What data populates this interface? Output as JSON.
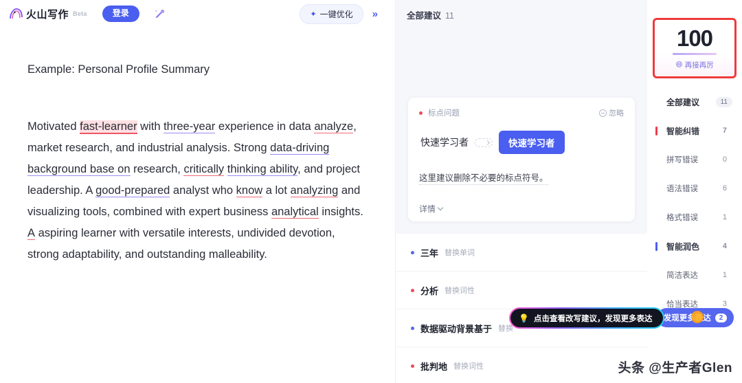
{
  "header": {
    "logo_icon": "volcano-logo-icon",
    "logo_text": "火山写作",
    "beta_badge": "Beta",
    "login_label": "登录",
    "magic_icon": "magic-wand-icon",
    "optimize_icon": "sparkle-icon",
    "optimize_label": "一键优化",
    "collapse_icon": "»"
  },
  "document": {
    "title": "Example: Personal Profile Summary",
    "line1_a": "Motivated ",
    "line1_err": "fast-learner",
    "line1_b": " with ",
    "line1_u1": "three-year",
    "line1_c": " experience in data",
    "line2_u1": "analyze",
    "line2_a": ", market research, and industrial analysis. Strong",
    "line3_u1": "data-driving background base on",
    "line3_a": " research, ",
    "line3_u2": "critically",
    "line4_u1": "thinking ability",
    "line4_a": ", and project leadership. A ",
    "line4_u2": "good-prepared",
    "line5_a": "analyst who ",
    "line5_u1": "know",
    "line5_b": " a lot ",
    "line5_u2": "analyzing",
    "line5_c": " and visualizing tools,",
    "line6_a": "combined with expert business ",
    "line6_u1": "analytical",
    "line6_b": " insights. ",
    "line6_u2": "A",
    "line7": "aspiring learner with versatile interests, undivided devotion,",
    "line8": "strong adaptability, and outstanding malleability."
  },
  "suggestions": {
    "header_label": "全部建议",
    "header_count": "11",
    "card": {
      "dot_color": "#ef4a5c",
      "tag": "标点问题",
      "ignore_icon": "ignore-circle-icon",
      "ignore_label": "忽略",
      "old_word": "快速学习者",
      "arrow_icon": "replace-arrow-icon",
      "new_word": "快速学习者",
      "description": "这里建议删除不必要的标点符号。",
      "more_label": "详情",
      "more_icon": "chevron-down-icon"
    },
    "items": [
      {
        "dot": "blue",
        "word": "三年",
        "kind": "替换单词"
      },
      {
        "dot": "red",
        "word": "分析",
        "kind": "替换词性"
      },
      {
        "dot": "blue",
        "word": "数据驱动背景基于",
        "kind": "替换"
      },
      {
        "dot": "red",
        "word": "批判地",
        "kind": "替换词性"
      }
    ],
    "tooltip": {
      "icon": "lightbulb-icon",
      "text": "点击查看改写建议，发现更多表达"
    }
  },
  "score_panel": {
    "score": "100",
    "emoji": "😄",
    "caption": "再接再厉",
    "border_color": "#ee3b3b"
  },
  "nav": {
    "all": {
      "label": "全部建议",
      "count": "11"
    },
    "groups": [
      {
        "label": "智能纠错",
        "count": "7",
        "accent": "#ee3b4c",
        "children": [
          {
            "label": "拼写错误",
            "count": "0"
          },
          {
            "label": "语法错误",
            "count": "6"
          },
          {
            "label": "格式错误",
            "count": "1"
          }
        ]
      },
      {
        "label": "智能润色",
        "count": "4",
        "accent": "#4a5ef0",
        "children": [
          {
            "label": "简洁表达",
            "count": "1"
          },
          {
            "label": "恰当表达",
            "count": "3"
          }
        ]
      }
    ],
    "discover": {
      "label": "发现更多表达",
      "count": "2"
    }
  },
  "watermark": "头条 @生产者Glen"
}
